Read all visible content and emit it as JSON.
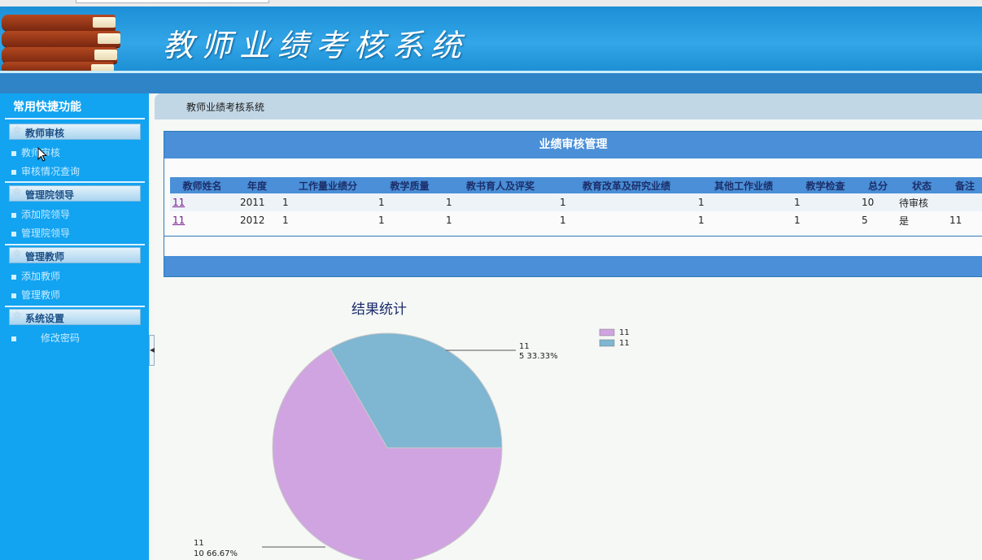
{
  "app": {
    "title": "教师业绩考核系统"
  },
  "sidebar": {
    "heading": "常用快捷功能",
    "groups": [
      {
        "label": "教师审核",
        "items": [
          "教师审核",
          "审核情况查询"
        ]
      },
      {
        "label": "管理院领导",
        "items": [
          "添加院领导",
          "管理院领导"
        ]
      },
      {
        "label": "管理教师",
        "items": [
          "添加教师",
          "管理教师"
        ]
      },
      {
        "label": "系统设置",
        "items": [
          "修改密码"
        ]
      }
    ]
  },
  "breadcrumb": "教师业绩考核系统",
  "panel": {
    "title": "业绩审核管理",
    "columns": [
      "教师姓名",
      "年度",
      "工作量业绩分",
      "教学质量",
      "教书育人及评奖",
      "教育改革及研究业绩",
      "其他工作业绩",
      "教学检查",
      "总分",
      "状态",
      "备注"
    ],
    "rows": [
      [
        "11",
        "2011",
        "1",
        "1",
        "1",
        "1",
        "1",
        "1",
        "10",
        "待审核",
        ""
      ],
      [
        "11",
        "2012",
        "1",
        "1",
        "1",
        "1",
        "1",
        "1",
        "5",
        "是",
        "11"
      ]
    ]
  },
  "chart_data": {
    "type": "pie",
    "title": "结果统计",
    "series": [
      {
        "name": "11",
        "value": 10,
        "percent": "66.67%",
        "color": "#d0a4e0",
        "label_line1": "11",
        "label_line2": "10 66.67%"
      },
      {
        "name": "11",
        "value": 5,
        "percent": "33.33%",
        "color": "#7fb6d1",
        "label_line1": "11",
        "label_line2": "5 33.33%"
      }
    ],
    "legend": {
      "position": "top-right",
      "entries": [
        "11",
        "11"
      ]
    }
  },
  "colors": {
    "header": "#1d8fd6",
    "sidebar": "#12a3f1",
    "table_header": "#4a8fd7"
  },
  "icons": [
    "star-icon",
    "bullet-icon",
    "collapse-arrow-icon",
    "mouse-cursor-icon"
  ]
}
